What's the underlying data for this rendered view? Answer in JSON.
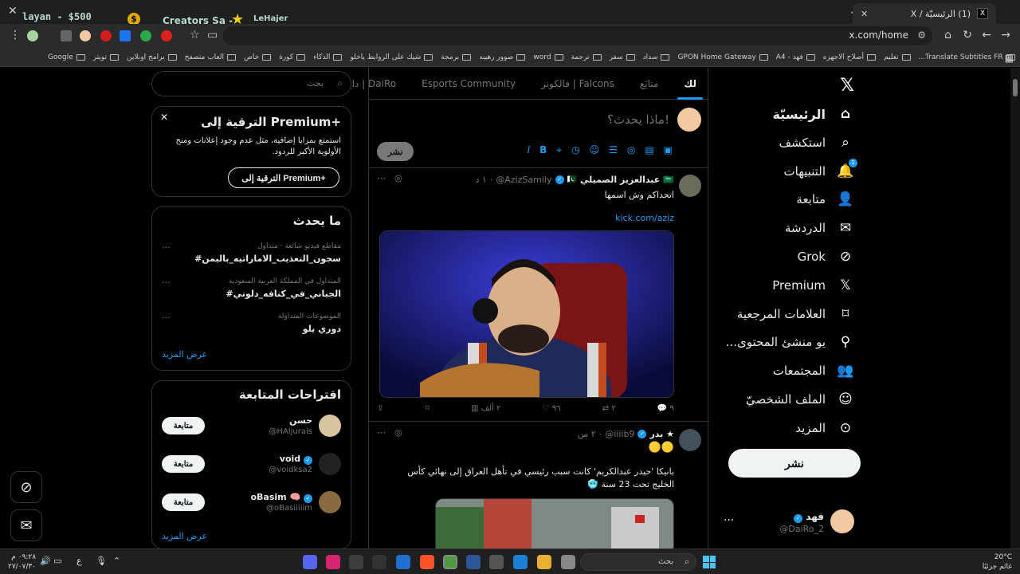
{
  "browser": {
    "tab_title": "(1) الرئيسيّة / X",
    "url": "x.com/home",
    "overlay_ad_1": "layan - $500",
    "overlay_ad_2": "Creators Sa -",
    "overlay_ad_3": "LeHajer",
    "bookmarks": [
      "Google",
      "تويتر",
      "برامج اونلاين",
      "العاب متصفح",
      "خاص",
      "كورة",
      "الذكاء",
      "شيك على الروابط ياخلو",
      "برمجة",
      "صوور رهيبه",
      "word",
      "ترجمة",
      "سفر",
      "سداد",
      "GPON Home Gateway",
      "فهد - A4",
      "أصلاح الاجهزه",
      "تعليم",
      "Translate Subtitles FR..."
    ]
  },
  "nav": {
    "items": [
      {
        "label": "الرئيسيّة",
        "icon": "home-icon"
      },
      {
        "label": "استكشف",
        "icon": "search-icon"
      },
      {
        "label": "التنبيهات",
        "icon": "bell-icon",
        "badge": "1"
      },
      {
        "label": "متابعة",
        "icon": "person-plus-icon"
      },
      {
        "label": "الدردشة",
        "icon": "mail-icon"
      },
      {
        "label": "Grok",
        "icon": "grok-icon"
      },
      {
        "label": "Premium",
        "icon": "x-icon"
      },
      {
        "label": "العلامات المرجعية",
        "icon": "bookmark-icon"
      },
      {
        "label": "...يو منشئ المحتوى",
        "icon": "creator-icon"
      },
      {
        "label": "المجتمعات",
        "icon": "communities-icon"
      },
      {
        "label": "الملف الشخصيّ",
        "icon": "profile-icon"
      },
      {
        "label": "المزيد",
        "icon": "more-icon"
      }
    ],
    "post_label": "نشر",
    "profile": {
      "name": "فهد",
      "handle": "@DaiRo_2"
    }
  },
  "main": {
    "tabs": [
      "لك",
      "متابَع",
      "فالكونز | Falcons",
      "Esports Community",
      "دايرو | DaiRo"
    ],
    "composer": {
      "placeholder": "ماذا يحدث؟!",
      "post_label": "نشر"
    },
    "tweets": [
      {
        "name": "عبدالعزيز الصميلي",
        "flags": "🇸🇦",
        "handle": "@AzizSamily",
        "time": "١ د",
        "text": "اتحداكم وش اسمها",
        "link": "kick.com/aziz",
        "replies": "٩",
        "reposts": "٢",
        "likes": "٩٦",
        "views": "٢ ألف"
      },
      {
        "name": "بدر ★",
        "handle": "@iiiib9",
        "time": "٢ س",
        "emoji": "🟡🟡",
        "text": "بانيكا 'حيدر عبدالكريم' كانت سبب رئيسي في تأهل العراق إلى نهائي كأس الخليج تحت 23 سنة 🥶"
      }
    ]
  },
  "sidebar": {
    "search_placeholder": "بحث",
    "premium": {
      "title": "الترقية إلى Premium+",
      "desc": "استمتع بمزايا إضافية، مثل عدم وجود إعلانات ومنح الأولوية الأكبر للردود.",
      "button": "الترقية إلى Premium+"
    },
    "trends": {
      "title": "ما يحدث",
      "items": [
        {
          "context": "مقاطع فيديو شائعة · متداول",
          "topic": "#سجون_التعذيب_الاماراتيه_باليمن"
        },
        {
          "context": "المتداول في المملكة العربية السعودية",
          "topic": "#الجباني_في_كنافه_دلوني"
        },
        {
          "context": "الموضوعات المتداوَلة",
          "topic": "دوري يلو"
        }
      ],
      "show_more": "عرض المزيد"
    },
    "follow": {
      "title": "اقتراحات المتابعة",
      "items": [
        {
          "name": "حسن",
          "handle": "@HAljurais",
          "verified": false
        },
        {
          "name": "void",
          "handle": "@voidksa2",
          "verified": true
        },
        {
          "name": "oBasim 🧠",
          "handle": "@oBasiiiiim",
          "verified": true
        }
      ],
      "follow_label": "متابعة",
      "show_more": "عرض المزيد"
    }
  },
  "taskbar": {
    "search_placeholder": "بحث",
    "weather_temp": "20°C",
    "weather_desc": "غائم جزئيًا",
    "time": "٠٩:٢٨ م",
    "date": "٢٧/٠٧/٣٠",
    "lang": "ع"
  }
}
